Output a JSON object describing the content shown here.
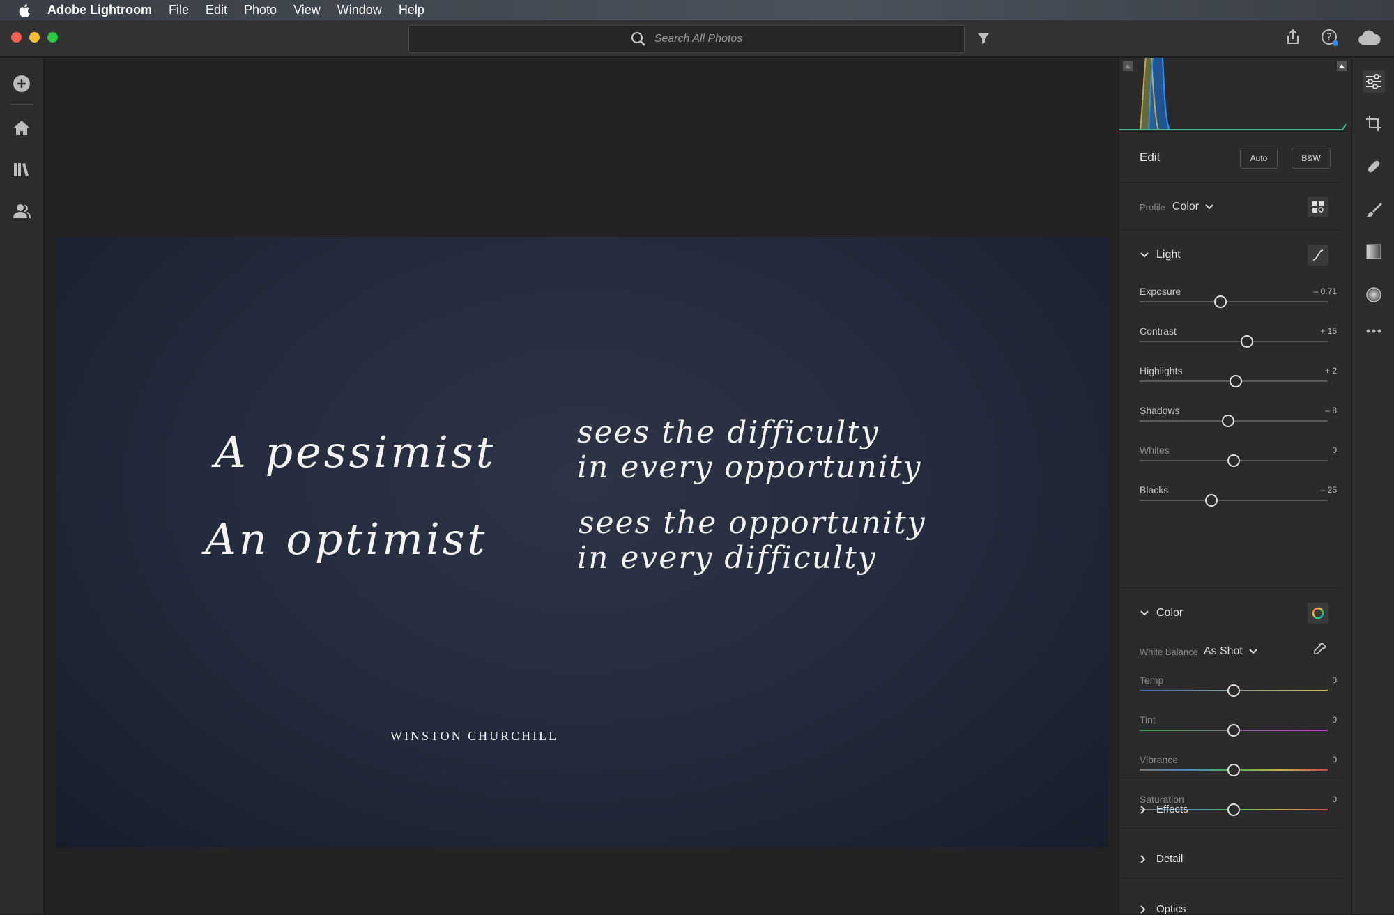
{
  "menubar": {
    "app_name": "Adobe Lightroom",
    "items": [
      "File",
      "Edit",
      "Photo",
      "View",
      "Window",
      "Help"
    ]
  },
  "search": {
    "placeholder": "Search All Photos"
  },
  "photo": {
    "line1_left": "A pessimist",
    "line1_right_a": "sees the difficulty",
    "line1_right_b": "in every opportunity",
    "line2_left": "An optimist",
    "line2_right_a": "sees the opportunity",
    "line2_right_b": "in every difficulty",
    "attribution": "WINSTON CHURCHILL"
  },
  "edit": {
    "title": "Edit",
    "auto_label": "Auto",
    "bw_label": "B&W",
    "profile_label": "Profile",
    "profile_value": "Color"
  },
  "light": {
    "title": "Light",
    "sliders": [
      {
        "label": "Exposure",
        "value": "– 0.71",
        "pos": 0.43
      },
      {
        "label": "Contrast",
        "value": "+ 15",
        "pos": 0.57
      },
      {
        "label": "Highlights",
        "value": "+ 2",
        "pos": 0.51
      },
      {
        "label": "Shadows",
        "value": "– 8",
        "pos": 0.47
      },
      {
        "label": "Whites",
        "value": "0",
        "pos": 0.5
      },
      {
        "label": "Blacks",
        "value": "– 25",
        "pos": 0.38
      }
    ]
  },
  "color": {
    "title": "Color",
    "wb_label": "White Balance",
    "wb_value": "As Shot",
    "sliders": [
      {
        "label": "Temp",
        "value": "0",
        "pos": 0.5
      },
      {
        "label": "Tint",
        "value": "0",
        "pos": 0.5
      },
      {
        "label": "Vibrance",
        "value": "0",
        "pos": 0.5
      },
      {
        "label": "Saturation",
        "value": "0",
        "pos": 0.5
      }
    ]
  },
  "sections": {
    "effects": "Effects",
    "detail": "Detail",
    "optics": "Optics"
  }
}
